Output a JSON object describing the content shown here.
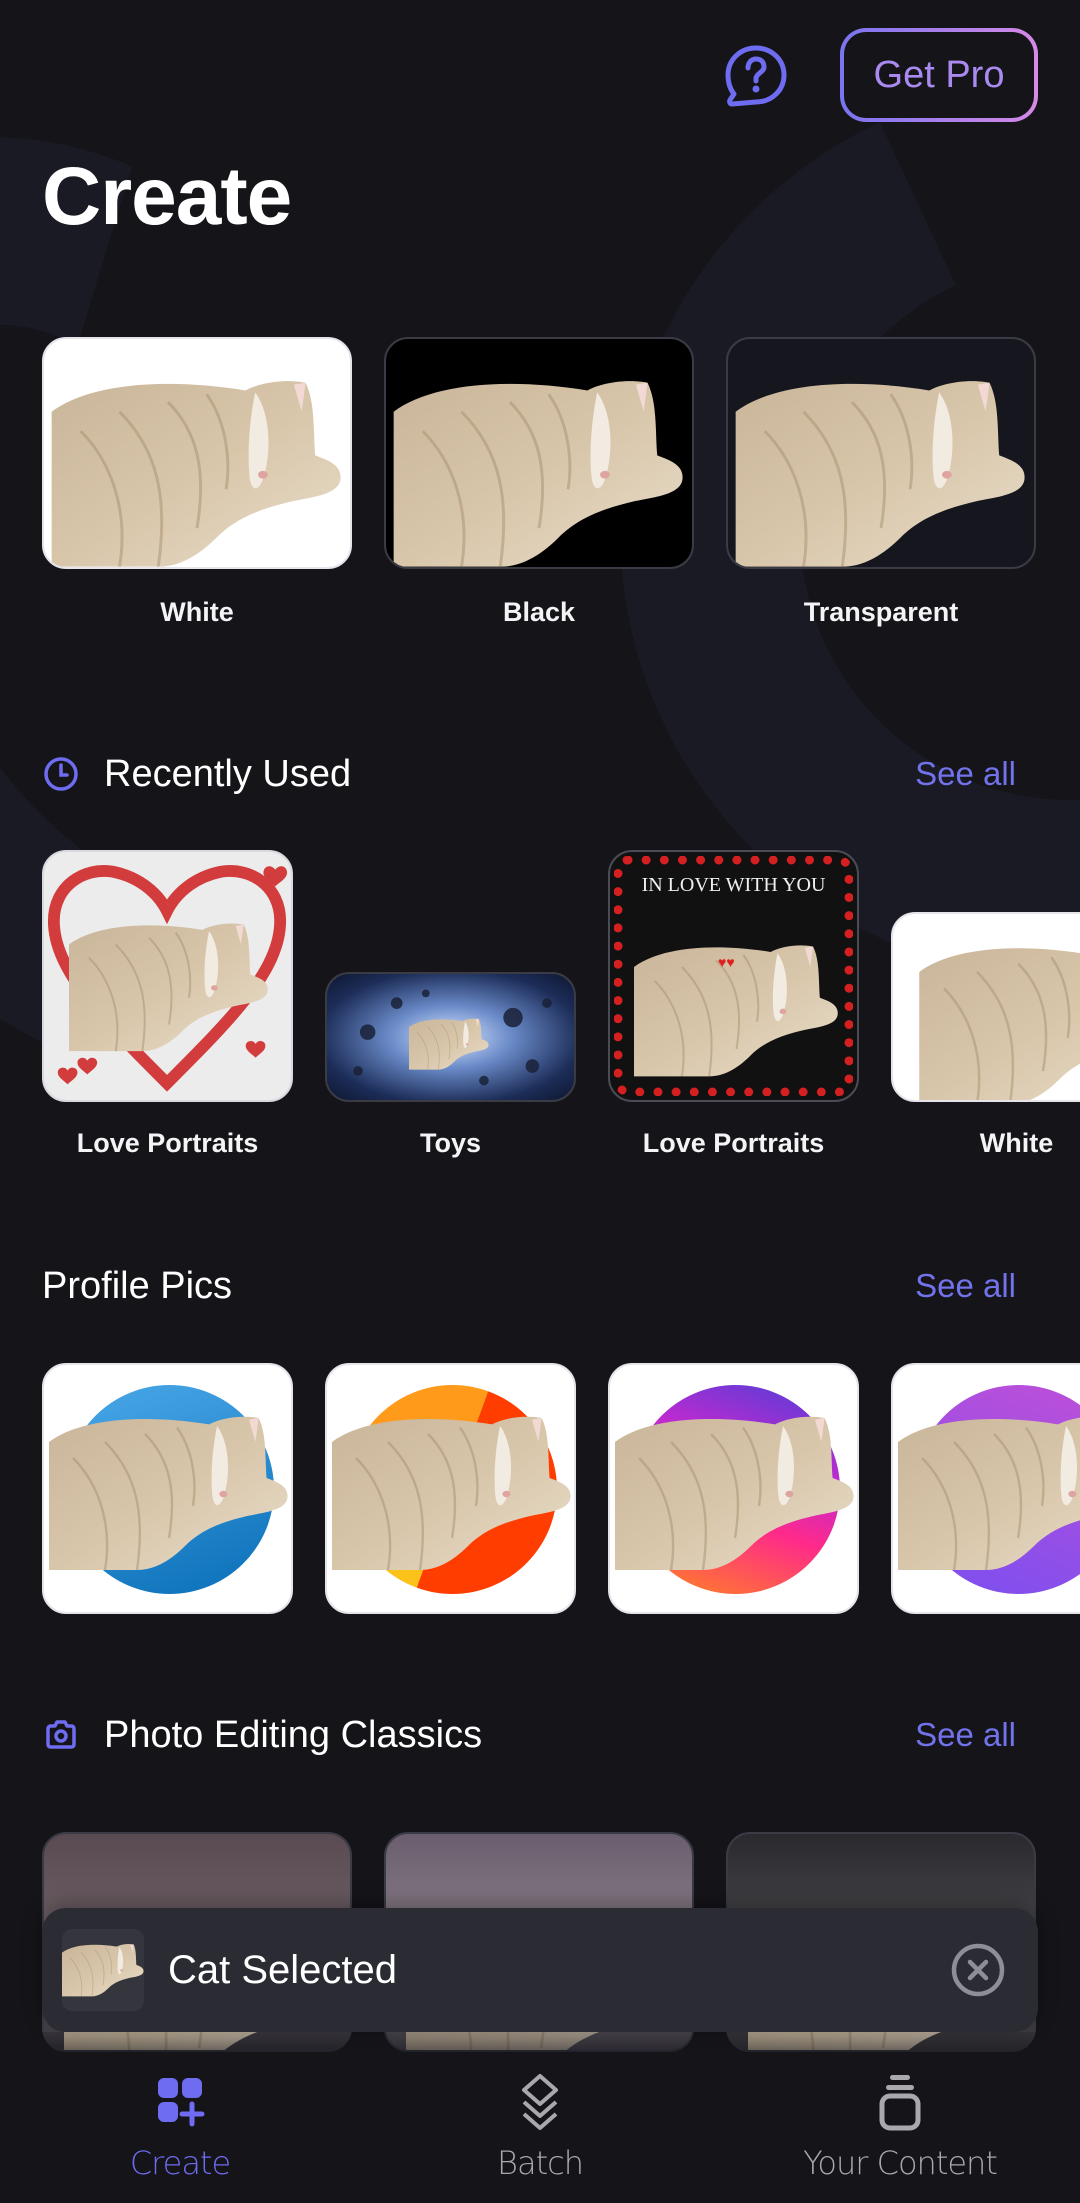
{
  "header": {
    "title": "Create",
    "help_icon": "help-chat-icon",
    "get_pro_label": "Get Pro"
  },
  "backgrounds": [
    {
      "label": "White",
      "bg": "white"
    },
    {
      "label": "Black",
      "bg": "black"
    },
    {
      "label": "Transparent",
      "bg": "transparent"
    }
  ],
  "recently_used": {
    "title": "Recently Used",
    "icon": "clock-icon",
    "see_all": "See all",
    "items": [
      {
        "label": "Love Portraits",
        "variant": "heart"
      },
      {
        "label": "Toys",
        "variant": "space"
      },
      {
        "label": "Love Portraits",
        "variant": "in-love",
        "caption": "IN LOVE WITH YOU"
      },
      {
        "label": "White",
        "variant": "white"
      }
    ]
  },
  "profile_pics": {
    "title": "Profile Pics",
    "see_all": "See all",
    "items": [
      {
        "name": "blue",
        "colors": [
          "#4aa8e8",
          "#0a6fb8"
        ]
      },
      {
        "name": "orange",
        "colors": [
          "#ff9a1a",
          "#ff3d00"
        ]
      },
      {
        "name": "sunset",
        "colors": [
          "#4a3fd8",
          "#ff2a8a",
          "#ff8a1a"
        ]
      },
      {
        "name": "purple",
        "colors": [
          "#c04fd8",
          "#7a4ff0"
        ]
      }
    ]
  },
  "photo_editing": {
    "title": "Photo Editing Classics",
    "icon": "camera-icon",
    "see_all": "See all"
  },
  "snackbar": {
    "text": "Cat Selected",
    "close_icon": "close-circle-icon"
  },
  "bottom_nav": {
    "items": [
      {
        "label": "Create",
        "icon": "create-grid-plus-icon",
        "active": true
      },
      {
        "label": "Batch",
        "icon": "layers-icon",
        "active": false
      },
      {
        "label": "Your Content",
        "icon": "stack-icon",
        "active": false
      }
    ]
  },
  "colors": {
    "accent": "#6e6cf0",
    "background": "#141419",
    "snackbar": "#2a2b33"
  }
}
